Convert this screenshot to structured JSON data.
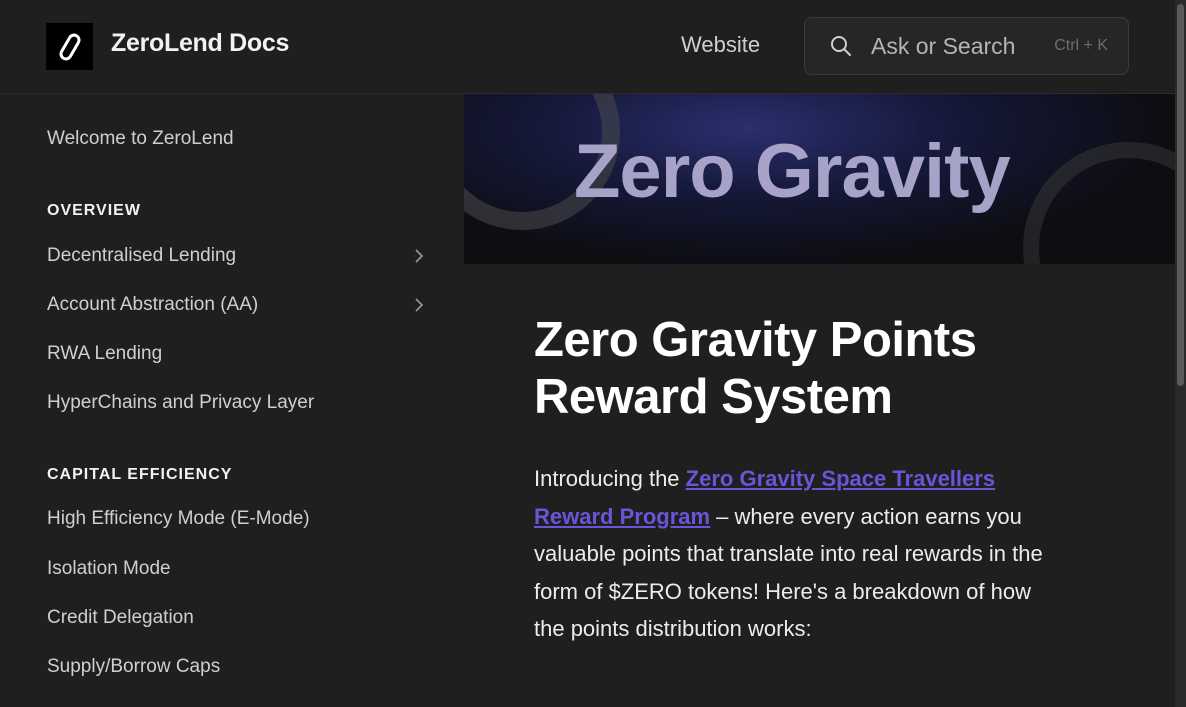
{
  "header": {
    "brand": "ZeroLend Docs",
    "website_link": "Website",
    "search": {
      "placeholder": "Ask or Search",
      "shortcut": "Ctrl + K"
    }
  },
  "sidebar": {
    "welcome": "Welcome to ZeroLend",
    "sections": [
      {
        "heading": "OVERVIEW",
        "items": [
          {
            "label": "Decentralised Lending",
            "expandable": true
          },
          {
            "label": "Account Abstraction (AA)",
            "expandable": true
          },
          {
            "label": "RWA Lending",
            "expandable": false
          },
          {
            "label": "HyperChains and Privacy Layer",
            "expandable": false
          }
        ]
      },
      {
        "heading": "CAPITAL EFFICIENCY",
        "items": [
          {
            "label": "High Efficiency Mode (E-Mode)"
          },
          {
            "label": "Isolation Mode"
          },
          {
            "label": "Credit Delegation"
          },
          {
            "label": "Supply/Borrow Caps"
          }
        ]
      }
    ]
  },
  "hero": {
    "title": "Zero Gravity"
  },
  "main": {
    "title": "Zero Gravity Points Reward System",
    "intro_prefix": "Introducing the ",
    "intro_link": "Zero Gravity Space Travellers Reward Program",
    "intro_suffix": " – where every action earns you valuable points that translate into real rewards in the form of $ZERO tokens! Here's a breakdown of how the points distribution works:"
  },
  "colors": {
    "background": "#1f1f1f",
    "link": "#6a55d8",
    "hero_text": "#a7a2c8"
  }
}
